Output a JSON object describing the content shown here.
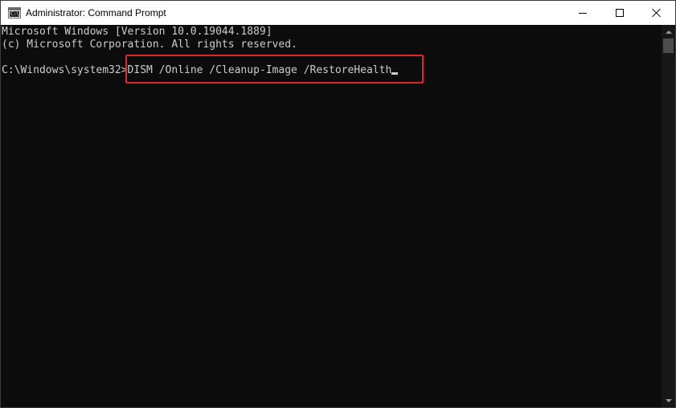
{
  "window": {
    "title": "Administrator: Command Prompt",
    "icon": "cmd-icon",
    "icon_glyph": "C:\\"
  },
  "controls": {
    "minimize_icon": "minimize-icon",
    "maximize_icon": "maximize-icon",
    "close_icon": "close-icon"
  },
  "console": {
    "lines": [
      "Microsoft Windows [Version 10.0.19044.1889]",
      "(c) Microsoft Corporation. All rights reserved.",
      ""
    ],
    "prompt": "C:\\Windows\\system32>",
    "command": "DISM /Online /Cleanup-Image /RestoreHealth"
  },
  "colors": {
    "background": "#0c0c0c",
    "text": "#cccccc",
    "titlebar": "#ffffff",
    "highlight": "#e0262d",
    "scroll_thumb": "#4d4d4d"
  }
}
